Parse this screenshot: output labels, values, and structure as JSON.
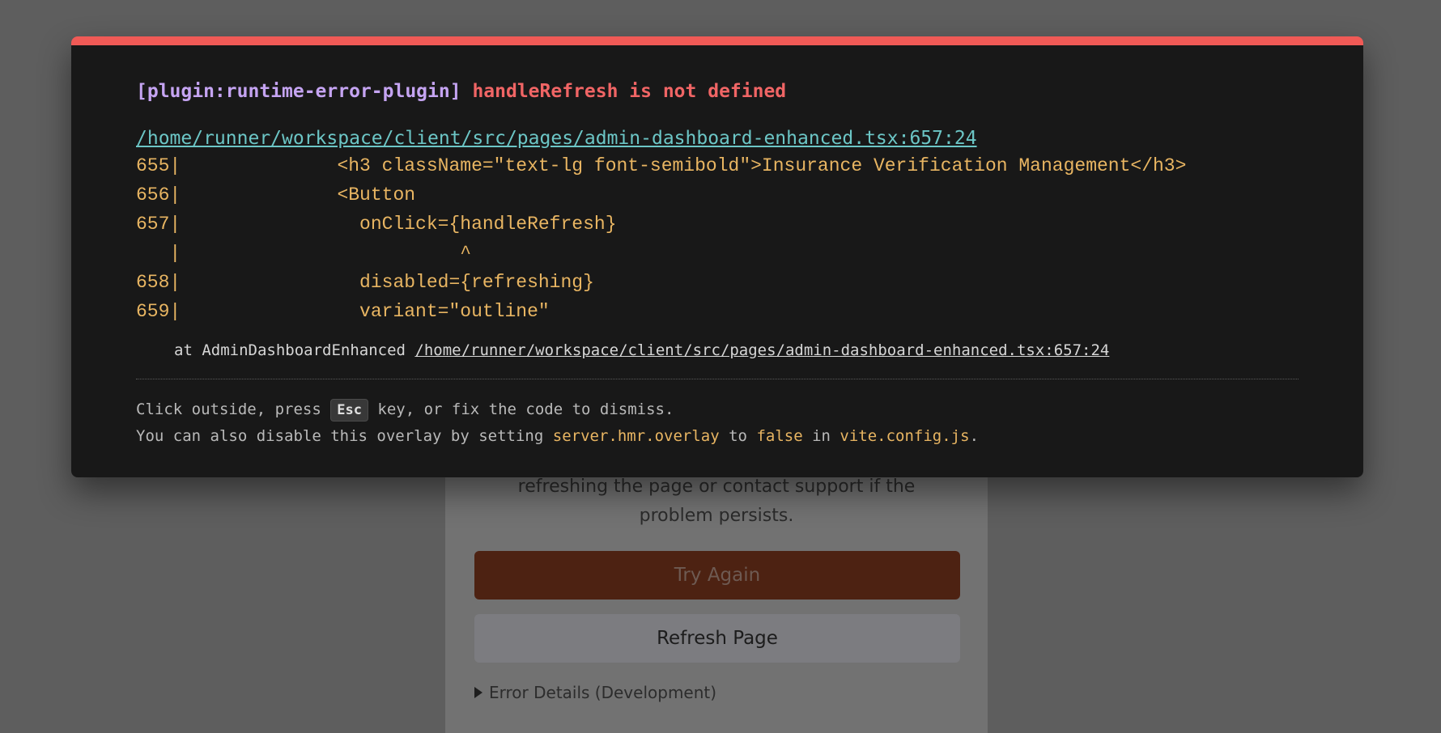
{
  "background": {
    "message_line1": "refreshing the page or contact support if the",
    "message_line2": "problem persists.",
    "try_again_label": "Try Again",
    "refresh_page_label": "Refresh Page",
    "error_details_label": "Error Details (Development)"
  },
  "overlay": {
    "accent_color": "#f05a56",
    "plugin_tag": "[plugin:runtime-error-plugin]",
    "error_message": "handleRefresh is not defined",
    "file_link": "/home/runner/workspace/client/src/pages/admin-dashboard-enhanced.tsx:657:24",
    "code_lines": [
      "655|              <h3 className=\"text-lg font-semibold\">Insurance Verification Management</h3>",
      "656|              <Button",
      "657|                onClick={handleRefresh}",
      "   |                         ^",
      "658|                disabled={refreshing}",
      "659|                variant=\"outline\""
    ],
    "stack_prefix": "at AdminDashboardEnhanced ",
    "stack_link": "/home/runner/workspace/client/src/pages/admin-dashboard-enhanced.tsx:657:24",
    "tip_line1_before": "Click outside, press ",
    "tip_key": "Esc",
    "tip_line1_after": " key, or fix the code to dismiss.",
    "tip_line2_part1": "You can also disable this overlay by setting ",
    "tip_line2_code1": "server.hmr.overlay",
    "tip_line2_part2": " to ",
    "tip_line2_code2": "false",
    "tip_line2_part3": " in ",
    "tip_line2_code3": "vite.config.js",
    "tip_line2_part4": "."
  }
}
